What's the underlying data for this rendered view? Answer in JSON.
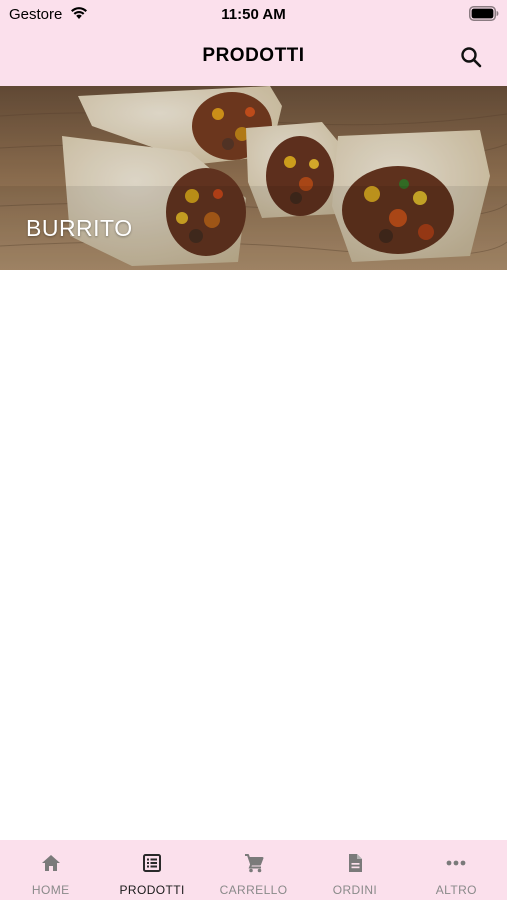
{
  "status_bar": {
    "carrier": "Gestore",
    "time": "11:50 AM",
    "wifi_icon": "wifi-icon",
    "battery_icon": "battery-icon"
  },
  "header": {
    "title": "PRODOTTI",
    "search_icon": "search-icon"
  },
  "categories": [
    {
      "label": "BURRITO",
      "image": "burrito-photo"
    }
  ],
  "tab_bar": {
    "active_index": 1,
    "active_color": "#1a1a1a",
    "inactive_color": "#8a8a8a",
    "background": "#fbe0ec",
    "tabs": [
      {
        "label": "HOME",
        "icon": "home-icon"
      },
      {
        "label": "PRODOTTI",
        "icon": "list-icon"
      },
      {
        "label": "CARRELLO",
        "icon": "cart-icon"
      },
      {
        "label": "ORDINI",
        "icon": "document-icon"
      },
      {
        "label": "ALTRO",
        "icon": "more-icon"
      }
    ]
  }
}
